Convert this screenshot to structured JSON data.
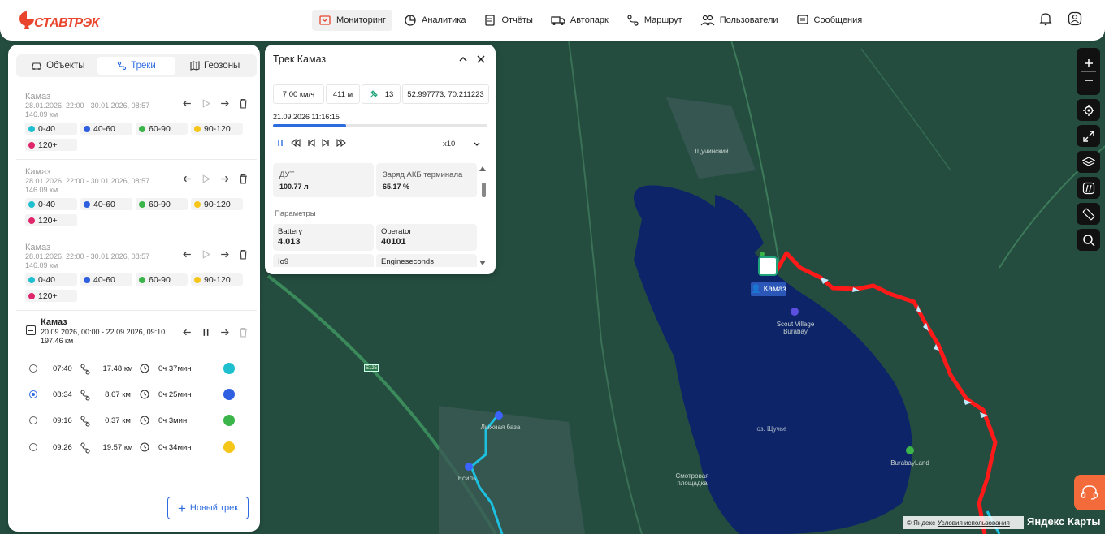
{
  "header": {
    "logo_text": "СТАВТРЭК",
    "nav": [
      {
        "label": "Мониторинг",
        "icon": "monitor-icon",
        "active": true
      },
      {
        "label": "Аналитика",
        "icon": "pie-chart-icon",
        "active": false
      },
      {
        "label": "Отчёты",
        "icon": "clipboard-icon",
        "active": false
      },
      {
        "label": "Автопарк",
        "icon": "truck-icon",
        "active": false
      },
      {
        "label": "Маршрут",
        "icon": "route-icon",
        "active": false
      },
      {
        "label": "Пользователи",
        "icon": "users-icon",
        "active": false
      },
      {
        "label": "Сообщения",
        "icon": "message-icon",
        "active": false
      }
    ]
  },
  "sidebar": {
    "tabs": [
      {
        "label": "Объекты",
        "icon": "car-icon",
        "active": false
      },
      {
        "label": "Треки",
        "icon": "route-icon",
        "active": true
      },
      {
        "label": "Геозоны",
        "icon": "map-icon",
        "active": false
      }
    ],
    "tracks": [
      {
        "name": "Камаз",
        "dates": "28.01.2026, 22:00 - 30.01.2026, 08:57",
        "distance": "146.09 км"
      },
      {
        "name": "Камаз",
        "dates": "28.01.2026, 22:00 - 30.01.2026, 08:57",
        "distance": "146.09 км"
      },
      {
        "name": "Камаз",
        "dates": "28.01.2026, 22:00 - 30.01.2026, 08:57",
        "distance": "146.09 км"
      }
    ],
    "legend": [
      {
        "label": "0-40",
        "color": "#1ec0cf"
      },
      {
        "label": "40-60",
        "color": "#2d5fe0"
      },
      {
        "label": "60-90",
        "color": "#3bb54a"
      },
      {
        "label": "90-120",
        "color": "#f5c518"
      },
      {
        "label": "120+",
        "color": "#e0266b"
      }
    ],
    "active_track": {
      "name": "Камаз",
      "dates": "20.09.2026, 00:00 - 22.09.2026, 09:10",
      "distance": "197.46 км",
      "trips": [
        {
          "time": "07:40",
          "distance": "17.48 км",
          "duration": "0ч 37мин",
          "color": "#1ec0cf",
          "selected": false
        },
        {
          "time": "08:34",
          "distance": "8.67 км",
          "duration": "0ч 25мин",
          "color": "#2d5fe0",
          "selected": true
        },
        {
          "time": "09:16",
          "distance": "0.37 км",
          "duration": "0ч 3мин",
          "color": "#3bb54a",
          "selected": false
        },
        {
          "time": "09:26",
          "distance": "19.57 км",
          "duration": "0ч 34мин",
          "color": "#f5c518",
          "selected": false
        }
      ]
    },
    "new_track_label": "Новый трек"
  },
  "popup": {
    "title": "Трек Камаз",
    "speed": "7.00 км/ч",
    "altitude": "411 м",
    "satellites": "13",
    "coords": "52.997773, 70.211223",
    "timestamp": "21.09.2026 11:16:15",
    "progress": 0.34,
    "playback_speed": "x10",
    "cells": [
      {
        "label": "ДУТ",
        "value": "100.77 л"
      },
      {
        "label": "Заряд АКБ терминала",
        "value": "65.17 %"
      }
    ],
    "params_label": "Параметры",
    "params": [
      {
        "label": "Battery",
        "value": "4.013"
      },
      {
        "label": "Operator",
        "value": "40101"
      },
      {
        "label": "Io9",
        "value": ""
      },
      {
        "label": "Engineseconds",
        "value": ""
      }
    ]
  },
  "map": {
    "labels": {
      "shchuchinsk": "Щучинский",
      "scout": "Scout Village Burabay",
      "lake": "оз. Щучье",
      "burabayland": "BurabayLand",
      "viewpoint": "Смотровая площадка",
      "lodge": "Лыжная база",
      "esil": "Есиль",
      "road": "E125"
    },
    "vehicle_tag": "Камаз",
    "copyright_prefix": "© Яндекс",
    "copyright_link": "Условия использования",
    "brand": "Яндекс Карты"
  }
}
